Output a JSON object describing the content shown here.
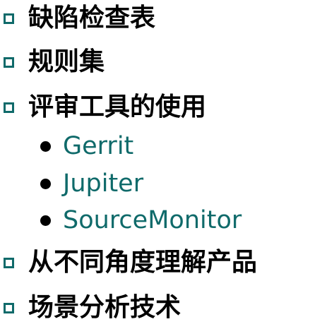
{
  "list": {
    "items": [
      {
        "label": "缺陷检查表"
      },
      {
        "label": "规则集"
      },
      {
        "label": "评审工具的使用"
      },
      {
        "label": "从不同角度理解产品"
      },
      {
        "label": "场景分析技术"
      }
    ],
    "sub_items": [
      {
        "label": "Gerrit"
      },
      {
        "label": "Jupiter"
      },
      {
        "label": "SourceMonitor"
      }
    ]
  },
  "colors": {
    "accent": "#0f6a6a",
    "text": "#000000"
  }
}
